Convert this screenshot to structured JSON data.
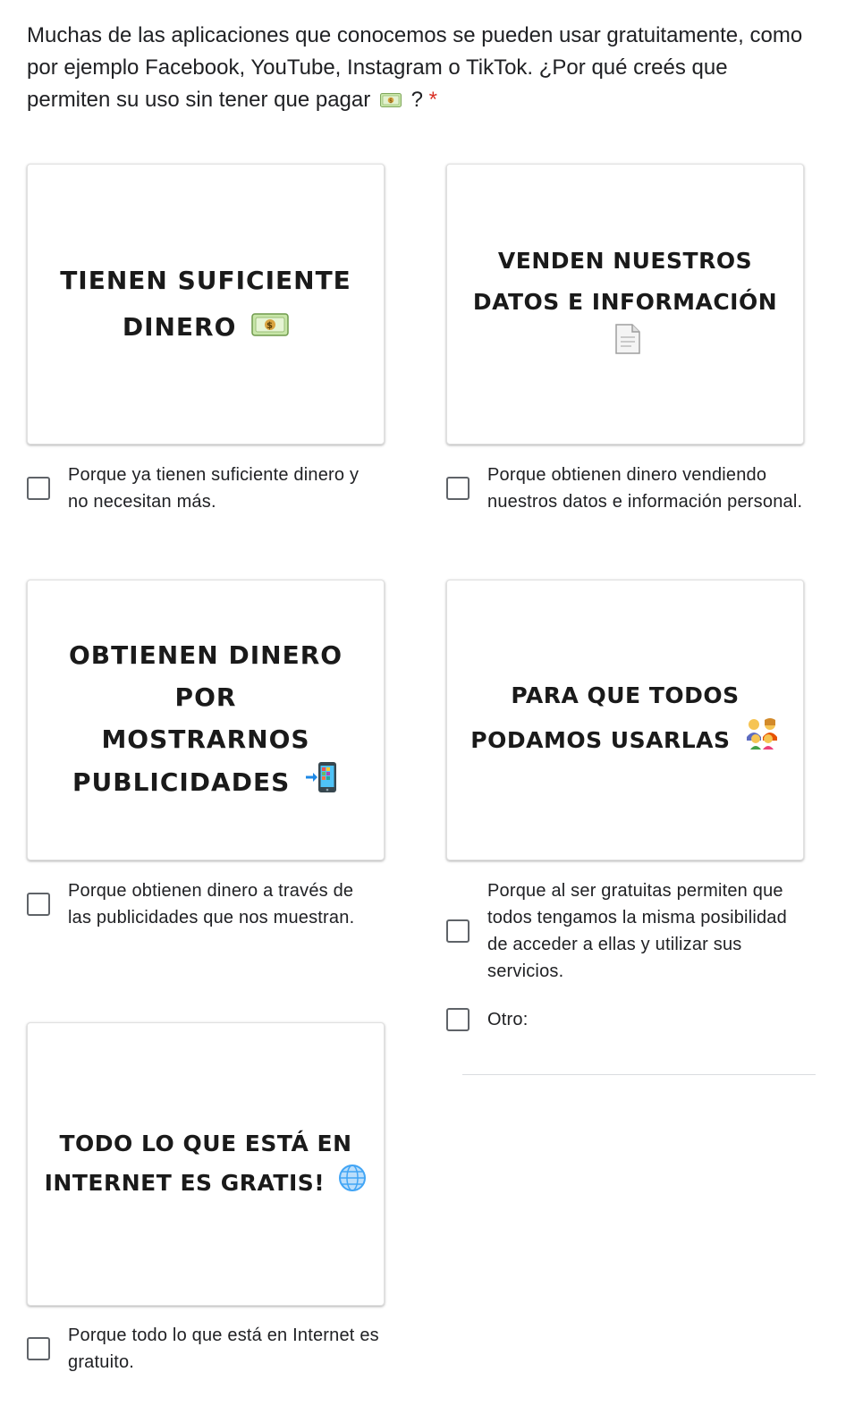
{
  "question": {
    "text": "Muchas de las aplicaciones que conocemos se pueden usar gratuitamente, como por ejemplo Facebook, YouTube, Instagram o TikTok. ¿Por qué creés que permiten su uso sin tener que pagar",
    "suffix": "?",
    "required_marker": "*"
  },
  "options": [
    {
      "image_text_1": "Tienen suficiente",
      "image_text_2": "dinero",
      "image_icon": "money-bill-icon",
      "label": "Porque ya tienen suficiente dinero y no necesitan más.",
      "checked": false
    },
    {
      "image_text_1": "Venden nuestros",
      "image_text_2": "datos e información",
      "image_icon": "document-icon",
      "label": "Porque obtienen dinero vendiendo nuestros datos e información personal.",
      "checked": false
    },
    {
      "image_text_1": "Obtienen dinero por",
      "image_text_2": "mostrarnos",
      "image_text_3": "publicidades",
      "image_icon": "mobile-arrow-icon",
      "label": "Porque obtienen dinero a través de las publicidades que nos muestran.",
      "checked": false
    },
    {
      "image_text_1": "Para que todos",
      "image_text_2": "podamos usarlas",
      "image_icon": "family-icon",
      "label": "Porque al ser gratuitas permiten que todos tengamos la misma posibilidad de acceder a ellas y utilizar sus servicios.",
      "checked": false
    },
    {
      "image_text_1": "Todo lo que está en",
      "image_text_2": "Internet es gratis!",
      "image_icon": "globe-icon",
      "label": "Porque todo lo que está en Internet es gratuito.",
      "checked": false
    }
  ],
  "other": {
    "label": "Otro:",
    "value": "",
    "checked": false
  },
  "colors": {
    "required": "#d93025",
    "checkbox_border": "#5f6368",
    "divider": "#dadce0",
    "text": "#202124"
  }
}
